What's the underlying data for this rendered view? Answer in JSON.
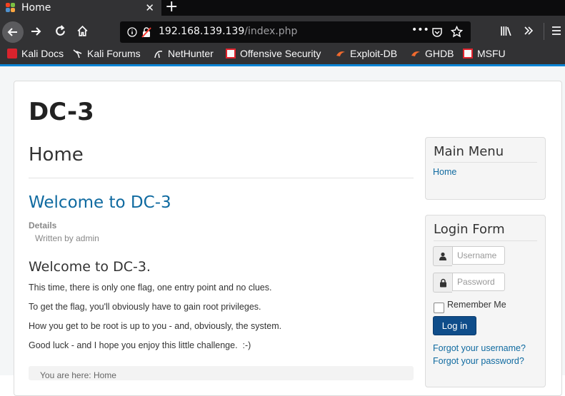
{
  "browser": {
    "tab": {
      "title": "Home",
      "close": "✕"
    },
    "new_tab": "+",
    "url": {
      "host": "192.168.139.139",
      "path": "/index.php"
    },
    "url_actions": "•••",
    "bookmarks": [
      {
        "label": "Kali Docs",
        "icon": "kali-icon"
      },
      {
        "label": "Kali Forums",
        "icon": "kali-dragon-icon"
      },
      {
        "label": "NetHunter",
        "icon": "nethunter-icon"
      },
      {
        "label": "Offensive Security",
        "icon": "offsec-icon"
      },
      {
        "label": "Exploit-DB",
        "icon": "exploitdb-icon"
      },
      {
        "label": "GHDB",
        "icon": "ghdb-icon"
      },
      {
        "label": "MSFU",
        "icon": "msfu-icon"
      }
    ]
  },
  "site": {
    "title": "DC-3",
    "page_heading": "Home",
    "article": {
      "title": "Welcome to DC-3",
      "details_label": "Details",
      "written_by": "Written by admin",
      "subheading": "Welcome to DC-3.",
      "paragraphs": [
        "This time, there is only one flag, one entry point and no clues.",
        "To get the flag, you'll obviously have to gain root privileges.",
        "How you get to be root is up to you - and, obviously, the system.",
        "Good luck - and I hope you enjoy this little challenge.  :-)"
      ],
      "footer_partial": "You are here: Home"
    },
    "main_menu": {
      "title": "Main Menu",
      "items": [
        "Home"
      ]
    },
    "login_form": {
      "title": "Login Form",
      "username_placeholder": "Username",
      "password_placeholder": "Password",
      "remember_label": "Remember Me",
      "login_button": "Log in",
      "forgot_username": "Forgot your username?",
      "forgot_password": "Forgot your password?"
    }
  },
  "colors": {
    "link": "#0f6aa0",
    "button": "#0f4d8a",
    "browser_chrome": "#323234"
  }
}
